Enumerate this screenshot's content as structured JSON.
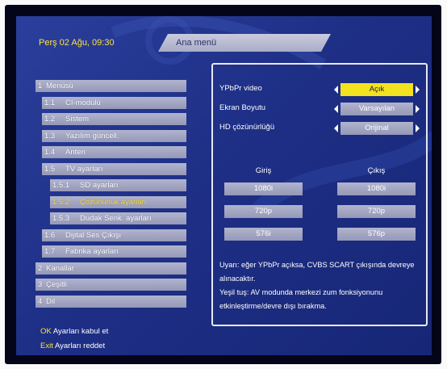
{
  "header": {
    "datetime": "Perş 02 Ağu, 09:30",
    "title": "Ana menü"
  },
  "menu": [
    {
      "num": "1",
      "label": "Menüsü",
      "level": 0
    },
    {
      "num": "1.1",
      "label": "CI-modülü",
      "level": 1
    },
    {
      "num": "1.2",
      "label": "Sistem",
      "level": 1
    },
    {
      "num": "1.3",
      "label": "Yazılım güncell.",
      "level": 1
    },
    {
      "num": "1.4",
      "label": "Anten",
      "level": 1
    },
    {
      "num": "1.5",
      "label": "TV ayarları",
      "level": 1
    },
    {
      "num": "1.5.1",
      "label": "SD ayarları",
      "level": 2
    },
    {
      "num": "1.5.2",
      "label": "Çözünürlük ayarları",
      "level": 2,
      "selected": true
    },
    {
      "num": "1.5.3",
      "label": "Dudak Senk. ayarları",
      "level": 2
    },
    {
      "num": "1.6",
      "label": "Dijital Ses Çıkışı",
      "level": 1
    },
    {
      "num": "1.7",
      "label": "Fabrika ayarları",
      "level": 1
    },
    {
      "num": "2",
      "label": "Kanallar",
      "level": 0
    },
    {
      "num": "3",
      "label": "Çeşitli",
      "level": 0
    },
    {
      "num": "4",
      "label": "Dil",
      "level": 0
    }
  ],
  "settings": [
    {
      "label": "YPbPr video",
      "value": "Açık",
      "active": true
    },
    {
      "label": "Ekran Boyutu",
      "value": "Varsayılan"
    },
    {
      "label": "HD çözünürlüğü",
      "value": "Orijinal"
    }
  ],
  "resolution": {
    "input_header": "Giriş",
    "output_header": "Çıkış",
    "inputs": [
      "1080i",
      "720p",
      "576i"
    ],
    "outputs": [
      "1080i",
      "720p",
      "576p"
    ]
  },
  "info": {
    "line1": "Uyarı: eğer YPbPr açıksa, CVBS SCART çıkışında devreye",
    "line2": "alınacaktır.",
    "line3": "Yeşil tuş: AV modunda merkezi zum fonksiyonunu",
    "line4": "etkinleştirme/devre dışı bırakma."
  },
  "hints": {
    "ok_key": "OK",
    "ok_text": " Ayarları kabul et",
    "exit_key": "Exit",
    "exit_text": " Ayarları reddet"
  },
  "colors": {
    "background": "#1e2f86",
    "highlight": "#ffe23a",
    "active_option": "#f2e21f",
    "item_bar": "#a3a6c2"
  }
}
